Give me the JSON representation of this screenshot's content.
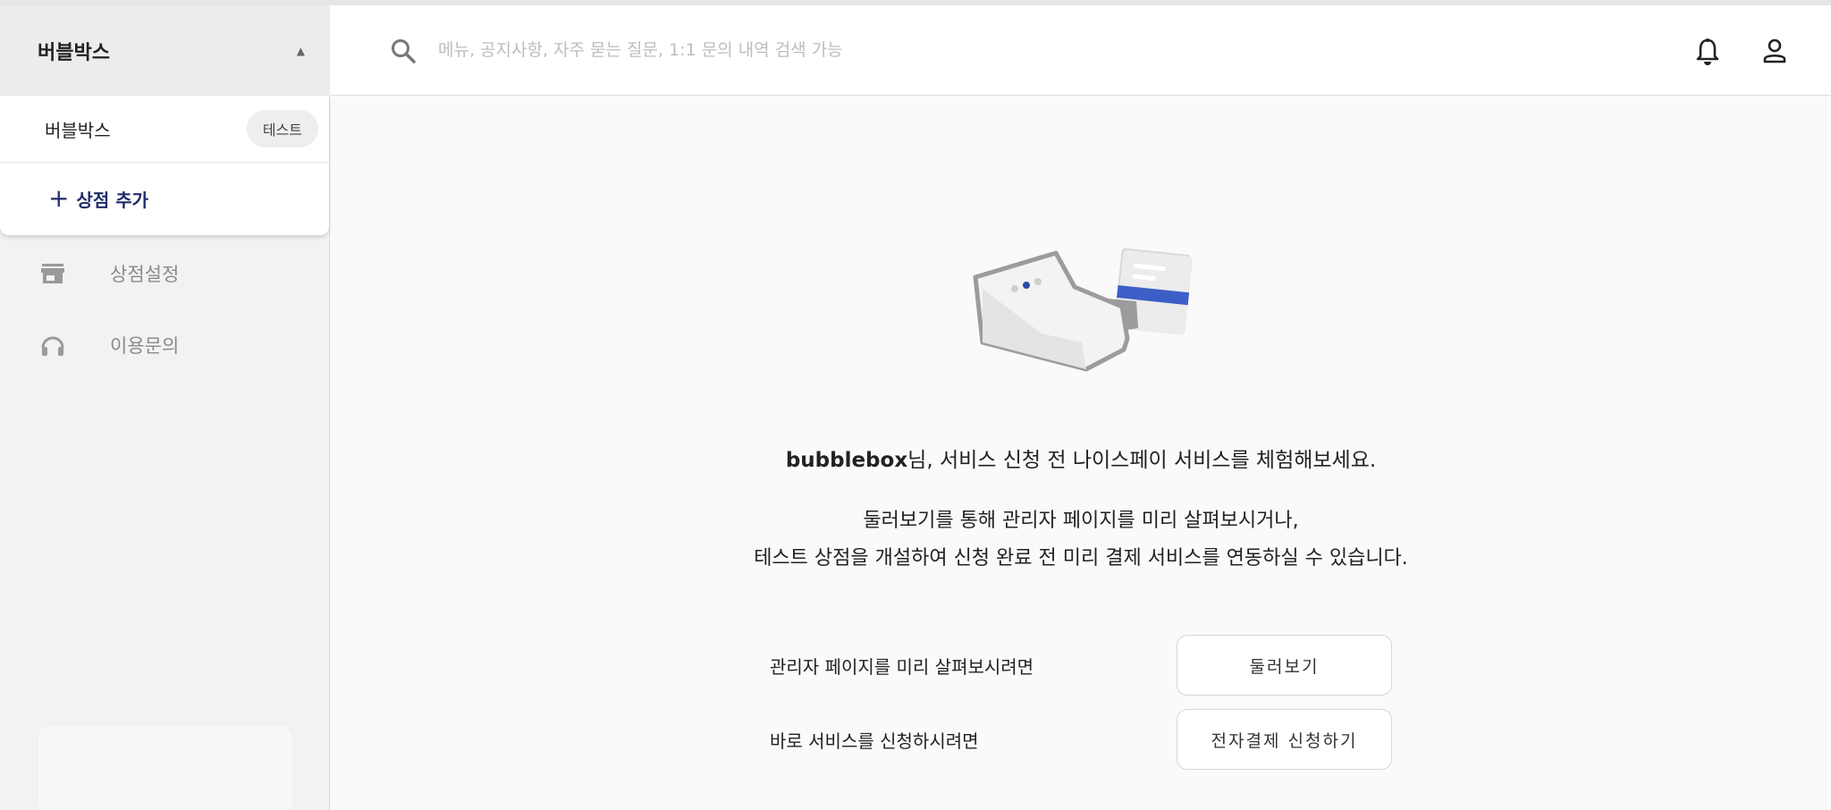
{
  "sidebar": {
    "store_selector": {
      "title": "버블박스",
      "caret": "▲"
    },
    "dropdown": {
      "items": [
        {
          "label": "버블박스",
          "badge": "테스트"
        }
      ],
      "add_label": "상점 추가",
      "add_symbol": "+"
    },
    "nav": [
      {
        "label": "상점설정",
        "icon": "store-icon"
      },
      {
        "label": "이용문의",
        "icon": "headset-icon"
      }
    ]
  },
  "header": {
    "search": {
      "placeholder": "메뉴, 공지사항, 자주 묻는 질문, 1:1 문의 내역 검색 가능",
      "value": ""
    },
    "icons": [
      "search-icon",
      "bell-icon",
      "user-icon"
    ]
  },
  "main": {
    "headline_user": "bubblebox",
    "headline_rest": "님, 서비스 신청 전 나이스페이 서비스를 체험해보세요.",
    "description": [
      "둘러보기를 통해 관리자 페이지를 미리 살펴보시거나,",
      "테스트 상점을 개설하여 신청 완료 전 미리 결제 서비스를 연동하실 수 있습니다."
    ],
    "actions": [
      {
        "text": "관리자 페이지를 미리 살펴보시려면",
        "button": "둘러보기"
      },
      {
        "text": "바로 서비스를 신청하시려면",
        "button": "전자결제 신청하기"
      }
    ]
  },
  "colors": {
    "accent_navy": "#1f2c6b",
    "card_stripe": "#3d5ec7",
    "sidebar_bg": "#f2f2f2",
    "page_bg": "#fafafa"
  }
}
